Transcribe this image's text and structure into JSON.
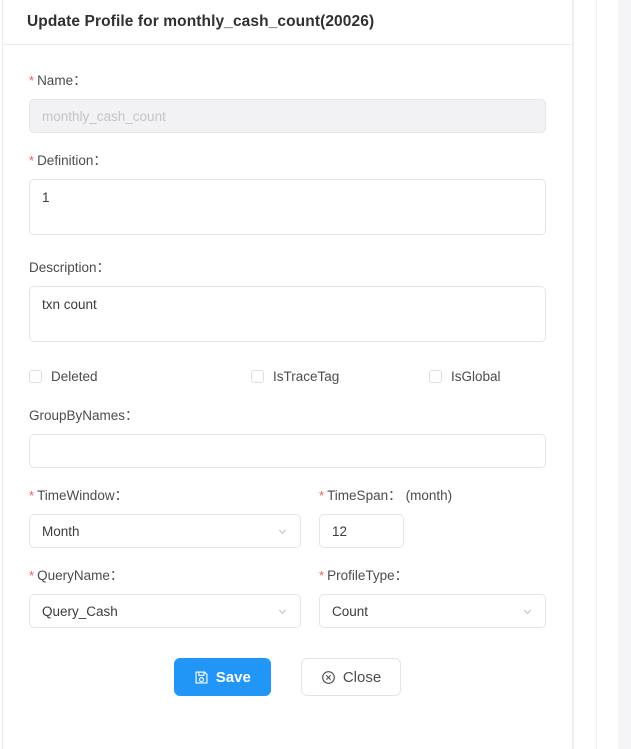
{
  "dialog": {
    "title": "Update Profile for monthly_cash_count(20026)"
  },
  "form": {
    "name": {
      "label": "Name",
      "colon": "：",
      "required": true,
      "value": "",
      "placeholder": "monthly_cash_count",
      "disabled": true
    },
    "definition": {
      "label": "Definition",
      "colon": "：",
      "required": true,
      "value": "1"
    },
    "description": {
      "label": "Description",
      "colon": "：",
      "required": false,
      "value": "txn count"
    },
    "checkboxes": [
      {
        "label": "Deleted",
        "checked": false
      },
      {
        "label": "IsTraceTag",
        "checked": false
      },
      {
        "label": "IsGlobal",
        "checked": false
      }
    ],
    "group_by_names": {
      "label": "GroupByNames",
      "colon": "：",
      "required": false,
      "value": ""
    },
    "time_window": {
      "label": "TimeWindow",
      "colon": "：",
      "required": true,
      "value": "Month"
    },
    "time_span": {
      "label": "TimeSpan",
      "colon": "：",
      "suffix": "(month)",
      "required": true,
      "value": "12"
    },
    "query_name": {
      "label": "QueryName",
      "colon": "：",
      "required": true,
      "value": "Query_Cash"
    },
    "profile_type": {
      "label": "ProfileType",
      "colon": "：",
      "required": true,
      "value": "Count"
    }
  },
  "footer": {
    "save_label": "Save",
    "save_icon": "save-floppy-icon",
    "close_label": "Close",
    "close_icon": "circle-x-icon"
  },
  "colors": {
    "primary": "#2196f7",
    "required_star": "#f45b5b",
    "border": "#e2e4e8",
    "disabled_bg": "#f2f2f4"
  }
}
